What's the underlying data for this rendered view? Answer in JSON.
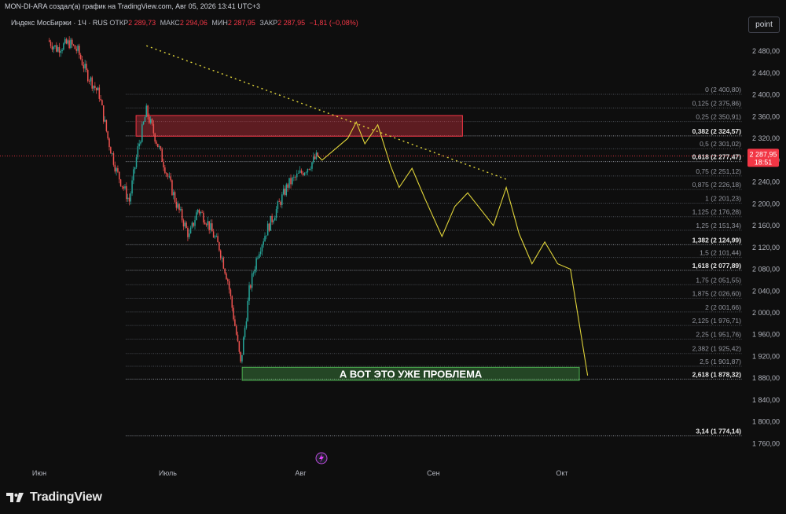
{
  "header": {
    "text": "MON-DI-ARA создал(а) график на TradingView.com, Авг 05, 2026 13:41 UTC+3"
  },
  "legend": {
    "symbol": "Индекс МосБиржи · 1Ч · RUS",
    "open_label": "ОТКР",
    "open": "2 289,73",
    "high_label": "МАКС",
    "high": "2 294,06",
    "low_label": "МИН",
    "low": "2 287,95",
    "close_label": "ЗАКР",
    "close": "2 287,95",
    "change": "−1,81 (−0,08%)"
  },
  "toolbar": {
    "point_label": "point"
  },
  "price_axis": {
    "ticks": [
      "2 480,00",
      "2 440,00",
      "2 400,00",
      "2 360,00",
      "2 320,00",
      "2 280,00",
      "2 240,00",
      "2 200,00",
      "2 160,00",
      "2 120,00",
      "2 080,00",
      "2 040,00",
      "2 000,00",
      "1 960,00",
      "1 920,00",
      "1 880,00",
      "1 840,00",
      "1 800,00",
      "1 760,00"
    ],
    "current_price": "2 287,95",
    "countdown": "18:51"
  },
  "time_axis": {
    "labels": [
      "Июн",
      "Июль",
      "Авг",
      "Сен",
      "Окт"
    ]
  },
  "fib_levels": [
    {
      "ratio": "0",
      "price": "2 400,80",
      "bold": false
    },
    {
      "ratio": "0,125",
      "price": "2 375,86",
      "bold": false
    },
    {
      "ratio": "0,25",
      "price": "2 350,91",
      "bold": false
    },
    {
      "ratio": "0,382",
      "price": "2 324,57",
      "bold": true
    },
    {
      "ratio": "0,5",
      "price": "2 301,02",
      "bold": false
    },
    {
      "ratio": "0,618",
      "price": "2 277,47",
      "bold": true
    },
    {
      "ratio": "0,75",
      "price": "2 251,12",
      "bold": false
    },
    {
      "ratio": "0,875",
      "price": "2 226,18",
      "bold": false
    },
    {
      "ratio": "1",
      "price": "2 201,23",
      "bold": false
    },
    {
      "ratio": "1,125",
      "price": "2 176,28",
      "bold": false
    },
    {
      "ratio": "1,25",
      "price": "2 151,34",
      "bold": false
    },
    {
      "ratio": "1,382",
      "price": "2 124,99",
      "bold": true
    },
    {
      "ratio": "1,5",
      "price": "2 101,44",
      "bold": false
    },
    {
      "ratio": "1,618",
      "price": "2 077,89",
      "bold": true
    },
    {
      "ratio": "1,75",
      "price": "2 051,55",
      "bold": false
    },
    {
      "ratio": "1,875",
      "price": "2 026,60",
      "bold": false
    },
    {
      "ratio": "2",
      "price": "2 001,66",
      "bold": false
    },
    {
      "ratio": "2,125",
      "price": "1 976,71",
      "bold": false
    },
    {
      "ratio": "2,25",
      "price": "1 951,76",
      "bold": false
    },
    {
      "ratio": "2,382",
      "price": "1 925,42",
      "bold": false
    },
    {
      "ratio": "2,5",
      "price": "1 901,87",
      "bold": false
    },
    {
      "ratio": "2,618",
      "price": "1 878,32",
      "bold": true
    },
    {
      "ratio": "3,14",
      "price": "1 774,14",
      "bold": true
    }
  ],
  "annotation": {
    "text": "А ВОТ ЭТО УЖЕ ПРОБЛЕМА"
  },
  "footer": {
    "brand": "TradingView"
  },
  "colors": {
    "up": "#26a69a",
    "down": "#ef5350",
    "projection": "#e0d43a",
    "zone_red": "#f23645",
    "zone_green": "#4caf50",
    "price_tag": "#f23645"
  },
  "chart_data": {
    "type": "candlestick",
    "timeframe": "1H",
    "ylim": [
      1740,
      2500
    ],
    "current_price": 2287.95,
    "candles_approx_close": [
      {
        "date": "2026-06-03",
        "close": 2500
      },
      {
        "date": "2026-06-05",
        "close": 2485
      },
      {
        "date": "2026-06-08",
        "close": 2495
      },
      {
        "date": "2026-06-10",
        "close": 2480
      },
      {
        "date": "2026-06-12",
        "close": 2440
      },
      {
        "date": "2026-06-15",
        "close": 2400
      },
      {
        "date": "2026-06-17",
        "close": 2320
      },
      {
        "date": "2026-06-19",
        "close": 2260
      },
      {
        "date": "2026-06-22",
        "close": 2205
      },
      {
        "date": "2026-06-24",
        "close": 2300
      },
      {
        "date": "2026-06-26",
        "close": 2370
      },
      {
        "date": "2026-06-29",
        "close": 2300
      },
      {
        "date": "2026-07-01",
        "close": 2250
      },
      {
        "date": "2026-07-03",
        "close": 2200
      },
      {
        "date": "2026-07-06",
        "close": 2140
      },
      {
        "date": "2026-07-08",
        "close": 2190
      },
      {
        "date": "2026-07-10",
        "close": 2170
      },
      {
        "date": "2026-07-13",
        "close": 2120
      },
      {
        "date": "2026-07-15",
        "close": 2060
      },
      {
        "date": "2026-07-17",
        "close": 1960
      },
      {
        "date": "2026-07-18",
        "close": 1905
      },
      {
        "date": "2026-07-20",
        "close": 2040
      },
      {
        "date": "2026-07-22",
        "close": 2110
      },
      {
        "date": "2026-07-24",
        "close": 2150
      },
      {
        "date": "2026-07-27",
        "close": 2200
      },
      {
        "date": "2026-07-29",
        "close": 2235
      },
      {
        "date": "2026-08-03",
        "close": 2270
      },
      {
        "date": "2026-08-05",
        "close": 2288
      }
    ],
    "projection_path": [
      {
        "date": "2026-08-06",
        "price": 2280
      },
      {
        "date": "2026-08-09",
        "price": 2300
      },
      {
        "date": "2026-08-12",
        "price": 2320
      },
      {
        "date": "2026-08-14",
        "price": 2350
      },
      {
        "date": "2026-08-16",
        "price": 2310
      },
      {
        "date": "2026-08-19",
        "price": 2345
      },
      {
        "date": "2026-08-22",
        "price": 2270
      },
      {
        "date": "2026-08-24",
        "price": 2230
      },
      {
        "date": "2026-08-27",
        "price": 2265
      },
      {
        "date": "2026-08-30",
        "price": 2210
      },
      {
        "date": "2026-09-03",
        "price": 2140
      },
      {
        "date": "2026-09-06",
        "price": 2195
      },
      {
        "date": "2026-09-09",
        "price": 2220
      },
      {
        "date": "2026-09-12",
        "price": 2190
      },
      {
        "date": "2026-09-15",
        "price": 2160
      },
      {
        "date": "2026-09-18",
        "price": 2230
      },
      {
        "date": "2026-09-21",
        "price": 2145
      },
      {
        "date": "2026-09-24",
        "price": 2090
      },
      {
        "date": "2026-09-27",
        "price": 2130
      },
      {
        "date": "2026-09-30",
        "price": 2090
      },
      {
        "date": "2026-10-03",
        "price": 2080
      },
      {
        "date": "2026-10-07",
        "price": 1885
      }
    ],
    "resistance_zone": {
      "from": "2026-06-19",
      "to": "2026-09-01",
      "low": 2324,
      "high": 2362
    },
    "support_zone": {
      "from": "2026-07-18",
      "to": "2026-10-08",
      "low": 1876,
      "high": 1900
    },
    "trendline": {
      "from": {
        "date": "2026-06-26",
        "price": 2490
      },
      "to": {
        "date": "2026-09-18",
        "price": 2245
      }
    }
  }
}
